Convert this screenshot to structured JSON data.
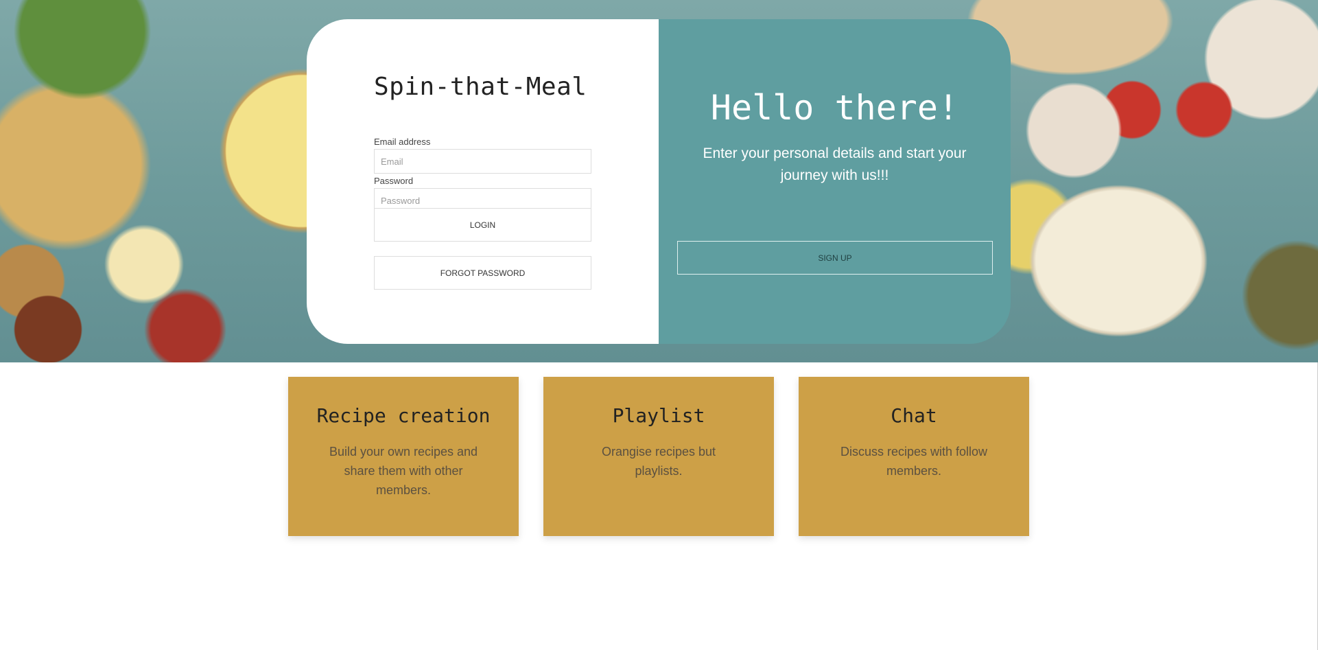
{
  "login": {
    "brand": "Spin-that-Meal",
    "email_label": "Email address",
    "email_placeholder": "Email",
    "password_label": "Password",
    "password_placeholder": "Password",
    "login_button": "LOGIN",
    "forgot_button": "FORGOT PASSWORD"
  },
  "signup_panel": {
    "heading": "Hello there!",
    "text": "Enter your personal details and start your journey with us!!!",
    "signup_button": "SIGN UP"
  },
  "features": [
    {
      "title": "Recipe creation",
      "desc": "Build your own recipes and share them with other members."
    },
    {
      "title": "Playlist",
      "desc": "Orangise recipes but playlists."
    },
    {
      "title": "Chat",
      "desc": "Discuss recipes with follow members."
    }
  ],
  "colors": {
    "panel": "#5f9ea0",
    "feature_card": "#cda047"
  }
}
